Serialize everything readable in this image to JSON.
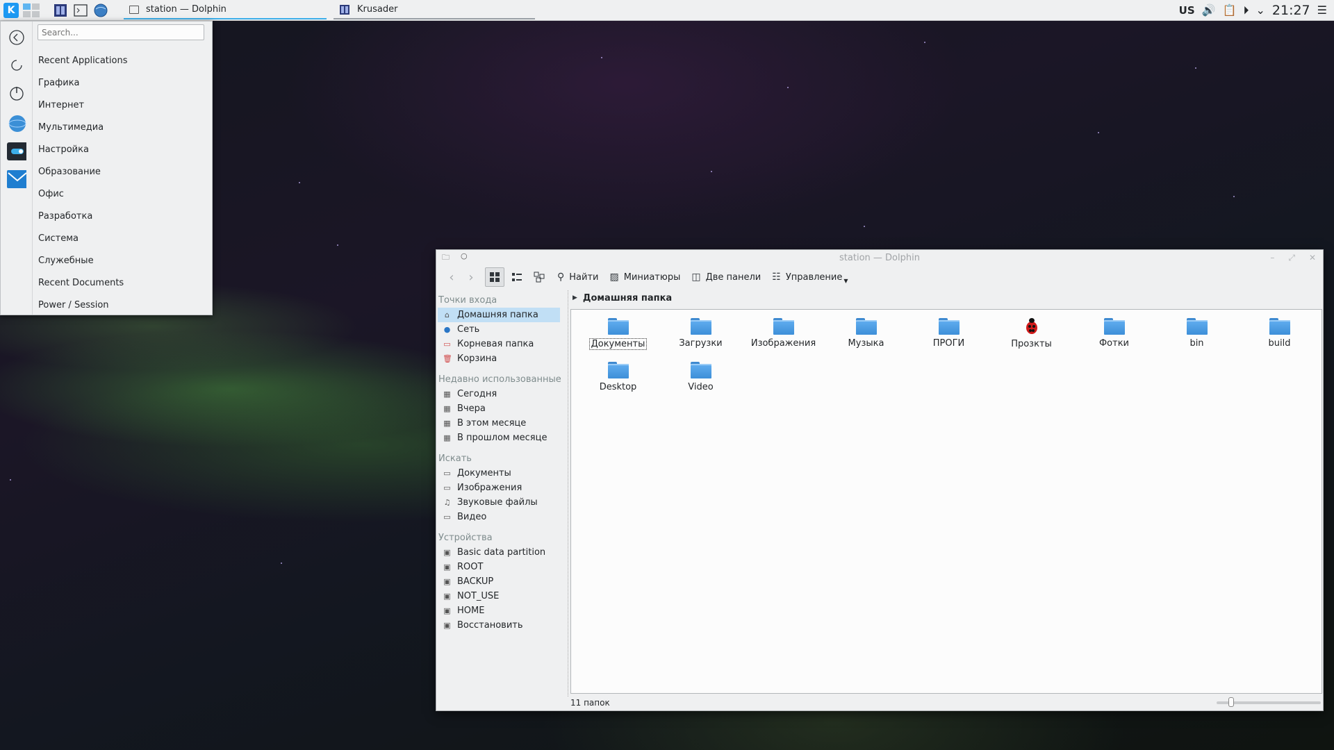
{
  "panel": {
    "tasks": [
      {
        "label": "station — Dolphin",
        "icon": "folder-icon"
      },
      {
        "label": "Krusader",
        "icon": "krusader-icon"
      }
    ],
    "tray": {
      "keyboard_layout": "US",
      "clock": "21:27"
    }
  },
  "launcher": {
    "search_placeholder": "Search...",
    "categories": [
      "Recent Applications",
      "Графика",
      "Интернет",
      "Мультимедиа",
      "Настройка",
      "Образование",
      "Офис",
      "Разработка",
      "Система",
      "Служебные",
      "Recent Documents",
      "Power / Session"
    ]
  },
  "dolphin": {
    "title": "station — Dolphin",
    "toolbar": {
      "find": "Найти",
      "preview": "Миниатюры",
      "split": "Две панели",
      "control": "Управление"
    },
    "places": {
      "sections": [
        {
          "title": "Точки входа",
          "items": [
            {
              "label": "Домашняя папка",
              "icon": "home-icon",
              "selected": true
            },
            {
              "label": "Сеть",
              "icon": "network-icon"
            },
            {
              "label": "Корневая папка",
              "icon": "root-folder-icon"
            },
            {
              "label": "Корзина",
              "icon": "trash-icon"
            }
          ]
        },
        {
          "title": "Недавно использованные",
          "items": [
            {
              "label": "Сегодня",
              "icon": "calendar-icon"
            },
            {
              "label": "Вчера",
              "icon": "calendar-icon"
            },
            {
              "label": "В этом месяце",
              "icon": "calendar-icon"
            },
            {
              "label": "В прошлом месяце",
              "icon": "calendar-icon"
            }
          ]
        },
        {
          "title": "Искать",
          "items": [
            {
              "label": "Документы",
              "icon": "folder-icon"
            },
            {
              "label": "Изображения",
              "icon": "folder-icon"
            },
            {
              "label": "Звуковые файлы",
              "icon": "music-icon"
            },
            {
              "label": "Видео",
              "icon": "folder-icon"
            }
          ]
        },
        {
          "title": "Устройства",
          "items": [
            {
              "label": "Basic data partition",
              "icon": "drive-icon"
            },
            {
              "label": "ROOT",
              "icon": "drive-icon"
            },
            {
              "label": "BACKUP",
              "icon": "drive-icon"
            },
            {
              "label": "NOT_USE",
              "icon": "drive-icon"
            },
            {
              "label": "HOME",
              "icon": "drive-icon"
            },
            {
              "label": "Восстановить",
              "icon": "drive-icon"
            }
          ]
        }
      ]
    },
    "breadcrumb": "Домашняя папка",
    "files": [
      {
        "label": "Документы",
        "icon": "folder-icon",
        "focused": true
      },
      {
        "label": "Загрузки",
        "icon": "folder-icon"
      },
      {
        "label": "Изображения",
        "icon": "folder-icon"
      },
      {
        "label": "Музыка",
        "icon": "folder-icon"
      },
      {
        "label": "ПРОГИ",
        "icon": "folder-icon"
      },
      {
        "label": "Прозкты",
        "icon": "ladybug-icon"
      },
      {
        "label": "Фотки",
        "icon": "folder-icon"
      },
      {
        "label": "bin",
        "icon": "folder-icon"
      },
      {
        "label": "build",
        "icon": "folder-icon"
      },
      {
        "label": "Desktop",
        "icon": "folder-icon"
      },
      {
        "label": "Video",
        "icon": "folder-icon"
      }
    ],
    "status": "11 папок",
    "zoom_fraction": 0.12
  }
}
